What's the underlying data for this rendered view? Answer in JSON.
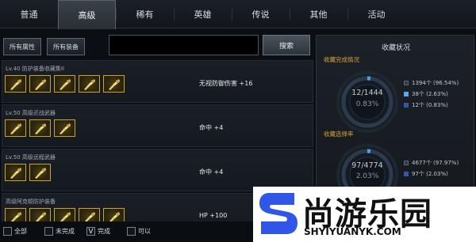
{
  "tabs": [
    {
      "label": "普通"
    },
    {
      "label": "高级",
      "active": true
    },
    {
      "label": "稀有"
    },
    {
      "label": "英雄"
    },
    {
      "label": "传说"
    },
    {
      "label": "其他"
    },
    {
      "label": "活动"
    }
  ],
  "filters": {
    "all_attributes": "所有属性",
    "all_equipment": "所有装备",
    "search_value": "",
    "search_label": "搜索"
  },
  "collections": [
    {
      "title": "Lv.40 防护装备收藏集II",
      "effect": "无视防御伤害 +16",
      "icon_count": 5
    },
    {
      "title": "Lv.50 高级近战武器",
      "effect": "命中 +4",
      "icon_count": 3
    },
    {
      "title": "Lv.50 高级远程武器",
      "effect": "命中 +4",
      "icon_count": 2
    },
    {
      "title": "高级阿克顿防护装备",
      "effect": "HP +100",
      "icon_count": 5
    }
  ],
  "status": {
    "title": "收藏状况",
    "completion": {
      "label": "收藏完成情况",
      "count_text": "12/1444",
      "percent_text": "0.83%",
      "legend": [
        {
          "text": "1394个 (96.54%)",
          "color": "#2b3a4c"
        },
        {
          "text": "38个 (2.63%)",
          "color": "#5aa8e8"
        },
        {
          "text": "12个 (0.83%)",
          "color": "#2d5aa8"
        }
      ],
      "fraction": 0.0083,
      "accent": "#4aa3e6"
    },
    "selection": {
      "label": "收藏选择率",
      "count_text": "97/4774",
      "percent_text": "2.03%",
      "legend": [
        {
          "text": "4677个 (97.97%)",
          "color": "#2b3a4c"
        },
        {
          "text": "97个 (2.03%)",
          "color": "#2d5aa8"
        }
      ],
      "fraction": 0.0203,
      "accent": "#4aa3e6"
    }
  },
  "bottom_filters": [
    {
      "label": "全部",
      "checked": false
    },
    {
      "label": "未完成",
      "checked": false
    },
    {
      "label": "完成",
      "checked": true
    },
    {
      "label": "可以",
      "checked": false
    }
  ],
  "watermark": {
    "text": "尚游乐园",
    "url": "SHYIYUANYK.COM"
  }
}
